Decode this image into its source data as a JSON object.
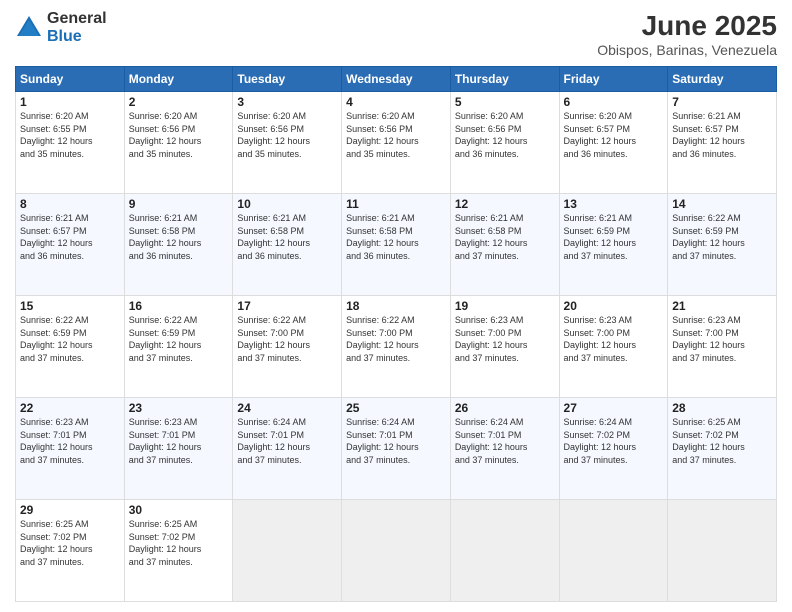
{
  "logo": {
    "general": "General",
    "blue": "Blue"
  },
  "title": "June 2025",
  "subtitle": "Obispos, Barinas, Venezuela",
  "headers": [
    "Sunday",
    "Monday",
    "Tuesday",
    "Wednesday",
    "Thursday",
    "Friday",
    "Saturday"
  ],
  "weeks": [
    [
      {
        "day": "1",
        "info": "Sunrise: 6:20 AM\nSunset: 6:55 PM\nDaylight: 12 hours\nand 35 minutes."
      },
      {
        "day": "2",
        "info": "Sunrise: 6:20 AM\nSunset: 6:56 PM\nDaylight: 12 hours\nand 35 minutes."
      },
      {
        "day": "3",
        "info": "Sunrise: 6:20 AM\nSunset: 6:56 PM\nDaylight: 12 hours\nand 35 minutes."
      },
      {
        "day": "4",
        "info": "Sunrise: 6:20 AM\nSunset: 6:56 PM\nDaylight: 12 hours\nand 35 minutes."
      },
      {
        "day": "5",
        "info": "Sunrise: 6:20 AM\nSunset: 6:56 PM\nDaylight: 12 hours\nand 36 minutes."
      },
      {
        "day": "6",
        "info": "Sunrise: 6:20 AM\nSunset: 6:57 PM\nDaylight: 12 hours\nand 36 minutes."
      },
      {
        "day": "7",
        "info": "Sunrise: 6:21 AM\nSunset: 6:57 PM\nDaylight: 12 hours\nand 36 minutes."
      }
    ],
    [
      {
        "day": "8",
        "info": "Sunrise: 6:21 AM\nSunset: 6:57 PM\nDaylight: 12 hours\nand 36 minutes."
      },
      {
        "day": "9",
        "info": "Sunrise: 6:21 AM\nSunset: 6:58 PM\nDaylight: 12 hours\nand 36 minutes."
      },
      {
        "day": "10",
        "info": "Sunrise: 6:21 AM\nSunset: 6:58 PM\nDaylight: 12 hours\nand 36 minutes."
      },
      {
        "day": "11",
        "info": "Sunrise: 6:21 AM\nSunset: 6:58 PM\nDaylight: 12 hours\nand 36 minutes."
      },
      {
        "day": "12",
        "info": "Sunrise: 6:21 AM\nSunset: 6:58 PM\nDaylight: 12 hours\nand 37 minutes."
      },
      {
        "day": "13",
        "info": "Sunrise: 6:21 AM\nSunset: 6:59 PM\nDaylight: 12 hours\nand 37 minutes."
      },
      {
        "day": "14",
        "info": "Sunrise: 6:22 AM\nSunset: 6:59 PM\nDaylight: 12 hours\nand 37 minutes."
      }
    ],
    [
      {
        "day": "15",
        "info": "Sunrise: 6:22 AM\nSunset: 6:59 PM\nDaylight: 12 hours\nand 37 minutes."
      },
      {
        "day": "16",
        "info": "Sunrise: 6:22 AM\nSunset: 6:59 PM\nDaylight: 12 hours\nand 37 minutes."
      },
      {
        "day": "17",
        "info": "Sunrise: 6:22 AM\nSunset: 7:00 PM\nDaylight: 12 hours\nand 37 minutes."
      },
      {
        "day": "18",
        "info": "Sunrise: 6:22 AM\nSunset: 7:00 PM\nDaylight: 12 hours\nand 37 minutes."
      },
      {
        "day": "19",
        "info": "Sunrise: 6:23 AM\nSunset: 7:00 PM\nDaylight: 12 hours\nand 37 minutes."
      },
      {
        "day": "20",
        "info": "Sunrise: 6:23 AM\nSunset: 7:00 PM\nDaylight: 12 hours\nand 37 minutes."
      },
      {
        "day": "21",
        "info": "Sunrise: 6:23 AM\nSunset: 7:00 PM\nDaylight: 12 hours\nand 37 minutes."
      }
    ],
    [
      {
        "day": "22",
        "info": "Sunrise: 6:23 AM\nSunset: 7:01 PM\nDaylight: 12 hours\nand 37 minutes."
      },
      {
        "day": "23",
        "info": "Sunrise: 6:23 AM\nSunset: 7:01 PM\nDaylight: 12 hours\nand 37 minutes."
      },
      {
        "day": "24",
        "info": "Sunrise: 6:24 AM\nSunset: 7:01 PM\nDaylight: 12 hours\nand 37 minutes."
      },
      {
        "day": "25",
        "info": "Sunrise: 6:24 AM\nSunset: 7:01 PM\nDaylight: 12 hours\nand 37 minutes."
      },
      {
        "day": "26",
        "info": "Sunrise: 6:24 AM\nSunset: 7:01 PM\nDaylight: 12 hours\nand 37 minutes."
      },
      {
        "day": "27",
        "info": "Sunrise: 6:24 AM\nSunset: 7:02 PM\nDaylight: 12 hours\nand 37 minutes."
      },
      {
        "day": "28",
        "info": "Sunrise: 6:25 AM\nSunset: 7:02 PM\nDaylight: 12 hours\nand 37 minutes."
      }
    ],
    [
      {
        "day": "29",
        "info": "Sunrise: 6:25 AM\nSunset: 7:02 PM\nDaylight: 12 hours\nand 37 minutes."
      },
      {
        "day": "30",
        "info": "Sunrise: 6:25 AM\nSunset: 7:02 PM\nDaylight: 12 hours\nand 37 minutes."
      },
      {
        "day": "",
        "info": ""
      },
      {
        "day": "",
        "info": ""
      },
      {
        "day": "",
        "info": ""
      },
      {
        "day": "",
        "info": ""
      },
      {
        "day": "",
        "info": ""
      }
    ]
  ]
}
